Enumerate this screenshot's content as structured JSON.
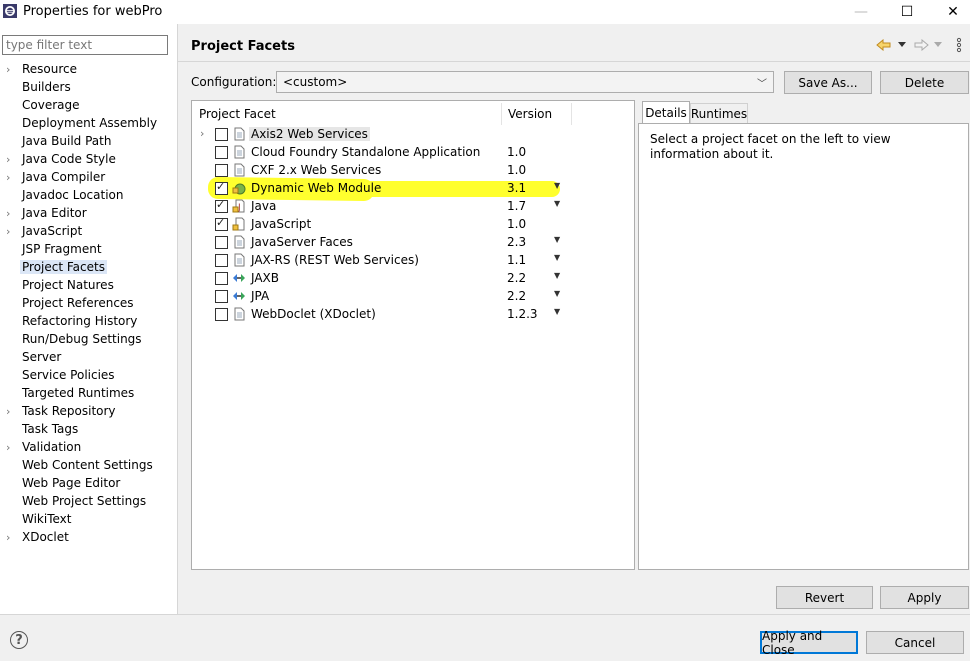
{
  "window": {
    "title": "Properties for webPro",
    "minimize": "—",
    "maximize": "☐",
    "close": "✕"
  },
  "filter": {
    "placeholder": "type filter text"
  },
  "tree": {
    "items": [
      {
        "label": "Resource",
        "expandable": true
      },
      {
        "label": "Builders",
        "expandable": false
      },
      {
        "label": "Coverage",
        "expandable": false
      },
      {
        "label": "Deployment Assembly",
        "expandable": false
      },
      {
        "label": "Java Build Path",
        "expandable": false
      },
      {
        "label": "Java Code Style",
        "expandable": true
      },
      {
        "label": "Java Compiler",
        "expandable": true
      },
      {
        "label": "Javadoc Location",
        "expandable": false
      },
      {
        "label": "Java Editor",
        "expandable": true
      },
      {
        "label": "JavaScript",
        "expandable": true
      },
      {
        "label": "JSP Fragment",
        "expandable": false
      },
      {
        "label": "Project Facets",
        "expandable": false,
        "selected": true
      },
      {
        "label": "Project Natures",
        "expandable": false
      },
      {
        "label": "Project References",
        "expandable": false
      },
      {
        "label": "Refactoring History",
        "expandable": false
      },
      {
        "label": "Run/Debug Settings",
        "expandable": false
      },
      {
        "label": "Server",
        "expandable": false
      },
      {
        "label": "Service Policies",
        "expandable": false
      },
      {
        "label": "Targeted Runtimes",
        "expandable": false
      },
      {
        "label": "Task Repository",
        "expandable": true
      },
      {
        "label": "Task Tags",
        "expandable": false
      },
      {
        "label": "Validation",
        "expandable": true
      },
      {
        "label": "Web Content Settings",
        "expandable": false
      },
      {
        "label": "Web Page Editor",
        "expandable": false
      },
      {
        "label": "Web Project Settings",
        "expandable": false
      },
      {
        "label": "WikiText",
        "expandable": false
      },
      {
        "label": "XDoclet",
        "expandable": true
      }
    ]
  },
  "page": {
    "title": "Project Facets"
  },
  "configuration": {
    "label": "Configuration:",
    "value": "<custom>",
    "save_as": "Save As...",
    "delete": "Delete"
  },
  "facets": {
    "col_facet": "Project Facet",
    "col_version": "Version",
    "rows": [
      {
        "name": "Axis2 Web Services",
        "version": "",
        "checked": false,
        "expandable": true,
        "icon": "page-icon",
        "dropdown": false
      },
      {
        "name": "Cloud Foundry Standalone Application",
        "version": "1.0",
        "checked": false,
        "icon": "page-icon",
        "dropdown": false
      },
      {
        "name": "CXF 2.x Web Services",
        "version": "1.0",
        "checked": false,
        "icon": "page-icon",
        "dropdown": false
      },
      {
        "name": "Dynamic Web Module",
        "version": "3.1",
        "checked": true,
        "icon": "web-module-icon",
        "dropdown": true
      },
      {
        "name": "Java",
        "version": "1.7",
        "checked": true,
        "icon": "java-lock-icon",
        "dropdown": true
      },
      {
        "name": "JavaScript",
        "version": "1.0",
        "checked": true,
        "icon": "js-lock-icon",
        "dropdown": false
      },
      {
        "name": "JavaServer Faces",
        "version": "2.3",
        "checked": false,
        "icon": "page-icon",
        "dropdown": true
      },
      {
        "name": "JAX-RS (REST Web Services)",
        "version": "1.1",
        "checked": false,
        "icon": "page-icon",
        "dropdown": true
      },
      {
        "name": "JAXB",
        "version": "2.2",
        "checked": false,
        "icon": "arrows-icon",
        "dropdown": true
      },
      {
        "name": "JPA",
        "version": "2.2",
        "checked": false,
        "icon": "arrows-icon",
        "dropdown": true
      },
      {
        "name": "WebDoclet (XDoclet)",
        "version": "1.2.3",
        "checked": false,
        "icon": "page-icon",
        "dropdown": true
      }
    ]
  },
  "details": {
    "tab_details": "Details",
    "tab_runtimes": "Runtimes",
    "text": "Select a project facet on the left to view information about it."
  },
  "buttons": {
    "revert": "Revert",
    "apply": "Apply",
    "apply_and_close": "Apply and Close",
    "cancel": "Cancel"
  },
  "help": {
    "glyph": "?"
  },
  "colors": {
    "highlight": "#ffff2e",
    "selection": "#dbe6f6",
    "accent": "#0078d7"
  }
}
